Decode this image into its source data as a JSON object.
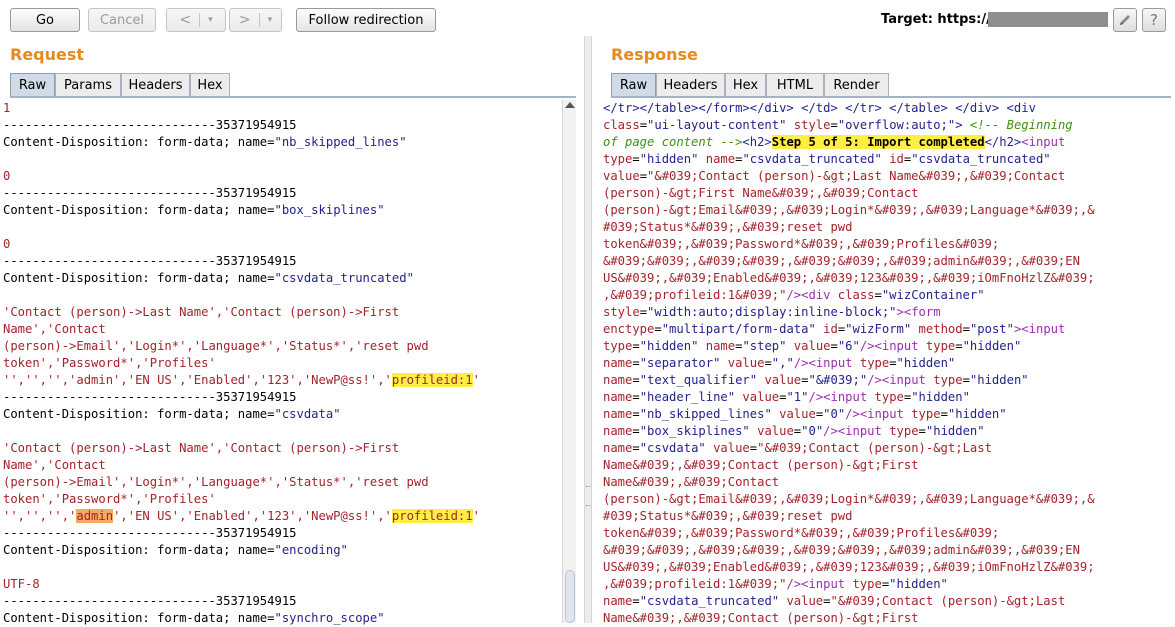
{
  "toolbar": {
    "go_label": "Go",
    "cancel_label": "Cancel",
    "back_glyph": "<",
    "forward_glyph": ">",
    "dropdown_glyph": "▾",
    "follow_label": "Follow redirection",
    "target_label": "Target: https://"
  },
  "request": {
    "title": "Request",
    "tabs": [
      "Raw",
      "Params",
      "Headers",
      "Hex"
    ],
    "lines": [
      [
        {
          "t": "1",
          "c": "red"
        }
      ],
      [
        {
          "t": "-----------------------------35371954915",
          "c": "black"
        }
      ],
      [
        {
          "t": "Content-Disposition: form-data; name=",
          "c": "black"
        },
        {
          "t": "\"nb_skipped_lines\"",
          "c": "blue"
        }
      ],
      [],
      [
        {
          "t": "0",
          "c": "red"
        }
      ],
      [
        {
          "t": "-----------------------------35371954915",
          "c": "black"
        }
      ],
      [
        {
          "t": "Content-Disposition: form-data; name=",
          "c": "black"
        },
        {
          "t": "\"box_skiplines\"",
          "c": "blue"
        }
      ],
      [],
      [
        {
          "t": "0",
          "c": "red"
        }
      ],
      [
        {
          "t": "-----------------------------35371954915",
          "c": "black"
        }
      ],
      [
        {
          "t": "Content-Disposition: form-data; name=",
          "c": "black"
        },
        {
          "t": "\"csvdata_truncated\"",
          "c": "blue"
        }
      ],
      [],
      [
        {
          "t": "'Contact (person)->Last Name','Contact (person)->First",
          "c": "red"
        }
      ],
      [
        {
          "t": "Name','Contact",
          "c": "red"
        }
      ],
      [
        {
          "t": "(person)->Email','Login*','Language*','Status*','reset pwd",
          "c": "red"
        }
      ],
      [
        {
          "t": "token','Password*','Profiles'",
          "c": "red"
        }
      ],
      [
        {
          "t": "'','','','admin','EN US','Enabled','123','NewP@ss!','",
          "c": "red"
        },
        {
          "t": "profileid:1",
          "c": "red",
          "hl": "yellow"
        },
        {
          "t": "'",
          "c": "red"
        }
      ],
      [
        {
          "t": "-----------------------------35371954915",
          "c": "black"
        }
      ],
      [
        {
          "t": "Content-Disposition: form-data; name=",
          "c": "black"
        },
        {
          "t": "\"csvdata\"",
          "c": "blue"
        }
      ],
      [],
      [
        {
          "t": "'Contact (person)->Last Name','Contact (person)->First",
          "c": "red"
        }
      ],
      [
        {
          "t": "Name','Contact",
          "c": "red"
        }
      ],
      [
        {
          "t": "(person)->Email','Login*','Language*','Status*','reset pwd",
          "c": "red"
        }
      ],
      [
        {
          "t": "token','Password*','Profiles'",
          "c": "red"
        }
      ],
      [
        {
          "t": "'','','','",
          "c": "red"
        },
        {
          "t": "admin",
          "c": "red",
          "hl": "orange"
        },
        {
          "t": "','EN US','Enabled','123','NewP@ss!','",
          "c": "red"
        },
        {
          "t": "profileid:1",
          "c": "red",
          "hl": "yellow"
        },
        {
          "t": "'",
          "c": "red"
        }
      ],
      [
        {
          "t": "-----------------------------35371954915",
          "c": "black"
        }
      ],
      [
        {
          "t": "Content-Disposition: form-data; name=",
          "c": "black"
        },
        {
          "t": "\"encoding\"",
          "c": "blue"
        }
      ],
      [],
      [
        {
          "t": "UTF-8",
          "c": "red"
        }
      ],
      [
        {
          "t": "-----------------------------35371954915",
          "c": "black"
        }
      ],
      [
        {
          "t": "Content-Disposition: form-data; name=",
          "c": "black"
        },
        {
          "t": "\"synchro_scope\"",
          "c": "blue"
        }
      ]
    ]
  },
  "response": {
    "title": "Response",
    "tabs": [
      "Raw",
      "Headers",
      "Hex",
      "HTML",
      "Render"
    ],
    "lines": [
      [
        {
          "t": "</tr></table></form></div> </td> </tr> </table> </div> <div",
          "c": "blue"
        }
      ],
      [
        {
          "t": "class",
          "c": "red"
        },
        {
          "t": "=",
          "c": "black"
        },
        {
          "t": "\"ui-layout-content\"",
          "c": "blue"
        },
        {
          "t": " style",
          "c": "red"
        },
        {
          "t": "=",
          "c": "black"
        },
        {
          "t": "\"overflow:auto;\"",
          "c": "blue"
        },
        {
          "t": "> ",
          "c": "blue"
        },
        {
          "t": "<!-- Beginning",
          "c": "green"
        }
      ],
      [
        {
          "t": "of page content -->",
          "c": "green"
        },
        {
          "t": "<h2>",
          "c": "blue"
        },
        {
          "t": "Step 5 of 5: Import completed",
          "c": "black",
          "hl": "yellow",
          "b": true
        },
        {
          "t": "</h2>",
          "c": "blue"
        },
        {
          "t": "<input",
          "c": "purple"
        }
      ],
      [
        {
          "t": "type",
          "c": "red"
        },
        {
          "t": "=",
          "c": "black"
        },
        {
          "t": "\"hidden\"",
          "c": "blue"
        },
        {
          "t": " name",
          "c": "red"
        },
        {
          "t": "=",
          "c": "black"
        },
        {
          "t": "\"csvdata_truncated\"",
          "c": "blue"
        },
        {
          "t": " id",
          "c": "red"
        },
        {
          "t": "=",
          "c": "black"
        },
        {
          "t": "\"csvdata_truncated\"",
          "c": "blue"
        }
      ],
      [
        {
          "t": "value",
          "c": "red"
        },
        {
          "t": "=",
          "c": "black"
        },
        {
          "t": "\"&#039;Contact (person)-&gt;Last Name&#039;,&#039;Contact",
          "c": "red"
        }
      ],
      [
        {
          "t": "(person)-&gt;First Name&#039;,&#039;Contact",
          "c": "red"
        }
      ],
      [
        {
          "t": "(person)-&gt;Email&#039;,&#039;Login*&#039;,&#039;Language*&#039;,&",
          "c": "red"
        }
      ],
      [
        {
          "t": "#039;Status*&#039;,&#039;reset pwd",
          "c": "red"
        }
      ],
      [
        {
          "t": "token&#039;,&#039;Password*&#039;,&#039;Profiles&#039;",
          "c": "red"
        }
      ],
      [
        {
          "t": "&#039;&#039;,&#039;&#039;,&#039;&#039;,&#039;admin&#039;,&#039;EN",
          "c": "red"
        }
      ],
      [
        {
          "t": "US&#039;,&#039;Enabled&#039;,&#039;123&#039;,&#039;iOmFnoHzlZ&#039;",
          "c": "red"
        }
      ],
      [
        {
          "t": ",&#039;profileid:1&#039;\"",
          "c": "red"
        },
        {
          "t": "/><div",
          "c": "purple"
        },
        {
          "t": " class",
          "c": "red"
        },
        {
          "t": "=",
          "c": "black"
        },
        {
          "t": "\"wizContainer\"",
          "c": "blue"
        }
      ],
      [
        {
          "t": "style",
          "c": "red"
        },
        {
          "t": "=",
          "c": "black"
        },
        {
          "t": "\"width:auto;display:inline-block;\"",
          "c": "blue"
        },
        {
          "t": "><form",
          "c": "purple"
        }
      ],
      [
        {
          "t": "enctype",
          "c": "red"
        },
        {
          "t": "=",
          "c": "black"
        },
        {
          "t": "\"multipart/form-data\"",
          "c": "blue"
        },
        {
          "t": " id",
          "c": "red"
        },
        {
          "t": "=",
          "c": "black"
        },
        {
          "t": "\"wizForm\"",
          "c": "blue"
        },
        {
          "t": " method",
          "c": "red"
        },
        {
          "t": "=",
          "c": "black"
        },
        {
          "t": "\"post\"",
          "c": "blue"
        },
        {
          "t": "><input",
          "c": "purple"
        }
      ],
      [
        {
          "t": "type",
          "c": "red"
        },
        {
          "t": "=",
          "c": "black"
        },
        {
          "t": "\"hidden\"",
          "c": "blue"
        },
        {
          "t": " name",
          "c": "red"
        },
        {
          "t": "=",
          "c": "black"
        },
        {
          "t": "\"step\"",
          "c": "blue"
        },
        {
          "t": " value",
          "c": "red"
        },
        {
          "t": "=",
          "c": "black"
        },
        {
          "t": "\"6\"",
          "c": "blue"
        },
        {
          "t": "/><input",
          "c": "purple"
        },
        {
          "t": " type",
          "c": "red"
        },
        {
          "t": "=",
          "c": "black"
        },
        {
          "t": "\"hidden\"",
          "c": "blue"
        }
      ],
      [
        {
          "t": "name",
          "c": "red"
        },
        {
          "t": "=",
          "c": "black"
        },
        {
          "t": "\"separator\"",
          "c": "blue"
        },
        {
          "t": " value",
          "c": "red"
        },
        {
          "t": "=",
          "c": "black"
        },
        {
          "t": "\",\"",
          "c": "blue"
        },
        {
          "t": "/><input",
          "c": "purple"
        },
        {
          "t": " type",
          "c": "red"
        },
        {
          "t": "=",
          "c": "black"
        },
        {
          "t": "\"hidden\"",
          "c": "blue"
        }
      ],
      [
        {
          "t": "name",
          "c": "red"
        },
        {
          "t": "=",
          "c": "black"
        },
        {
          "t": "\"text_qualifier\"",
          "c": "blue"
        },
        {
          "t": " value",
          "c": "red"
        },
        {
          "t": "=",
          "c": "black"
        },
        {
          "t": "\"&#039;\"",
          "c": "blue"
        },
        {
          "t": "/><input",
          "c": "purple"
        },
        {
          "t": " type",
          "c": "red"
        },
        {
          "t": "=",
          "c": "black"
        },
        {
          "t": "\"hidden\"",
          "c": "blue"
        }
      ],
      [
        {
          "t": "name",
          "c": "red"
        },
        {
          "t": "=",
          "c": "black"
        },
        {
          "t": "\"header_line\"",
          "c": "blue"
        },
        {
          "t": " value",
          "c": "red"
        },
        {
          "t": "=",
          "c": "black"
        },
        {
          "t": "\"1\"",
          "c": "blue"
        },
        {
          "t": "/><input",
          "c": "purple"
        },
        {
          "t": " type",
          "c": "red"
        },
        {
          "t": "=",
          "c": "black"
        },
        {
          "t": "\"hidden\"",
          "c": "blue"
        }
      ],
      [
        {
          "t": "name",
          "c": "red"
        },
        {
          "t": "=",
          "c": "black"
        },
        {
          "t": "\"nb_skipped_lines\"",
          "c": "blue"
        },
        {
          "t": " value",
          "c": "red"
        },
        {
          "t": "=",
          "c": "black"
        },
        {
          "t": "\"0\"",
          "c": "blue"
        },
        {
          "t": "/><input",
          "c": "purple"
        },
        {
          "t": " type",
          "c": "red"
        },
        {
          "t": "=",
          "c": "black"
        },
        {
          "t": "\"hidden\"",
          "c": "blue"
        }
      ],
      [
        {
          "t": "name",
          "c": "red"
        },
        {
          "t": "=",
          "c": "black"
        },
        {
          "t": "\"box_skiplines\"",
          "c": "blue"
        },
        {
          "t": " value",
          "c": "red"
        },
        {
          "t": "=",
          "c": "black"
        },
        {
          "t": "\"0\"",
          "c": "blue"
        },
        {
          "t": "/><input",
          "c": "purple"
        },
        {
          "t": " type",
          "c": "red"
        },
        {
          "t": "=",
          "c": "black"
        },
        {
          "t": "\"hidden\"",
          "c": "blue"
        }
      ],
      [
        {
          "t": "name",
          "c": "red"
        },
        {
          "t": "=",
          "c": "black"
        },
        {
          "t": "\"csvdata\"",
          "c": "blue"
        },
        {
          "t": " value",
          "c": "red"
        },
        {
          "t": "=",
          "c": "black"
        },
        {
          "t": "\"&#039;Contact (person)-&gt;Last",
          "c": "red"
        }
      ],
      [
        {
          "t": "Name&#039;,&#039;Contact (person)-&gt;First",
          "c": "red"
        }
      ],
      [
        {
          "t": "Name&#039;,&#039;Contact",
          "c": "red"
        }
      ],
      [
        {
          "t": "(person)-&gt;Email&#039;,&#039;Login*&#039;,&#039;Language*&#039;,&",
          "c": "red"
        }
      ],
      [
        {
          "t": "#039;Status*&#039;,&#039;reset pwd",
          "c": "red"
        }
      ],
      [
        {
          "t": "token&#039;,&#039;Password*&#039;,&#039;Profiles&#039;",
          "c": "red"
        }
      ],
      [
        {
          "t": "&#039;&#039;,&#039;&#039;,&#039;&#039;,&#039;admin&#039;,&#039;EN",
          "c": "red"
        }
      ],
      [
        {
          "t": "US&#039;,&#039;Enabled&#039;,&#039;123&#039;,&#039;iOmFnoHzlZ&#039;",
          "c": "red"
        }
      ],
      [
        {
          "t": ",&#039;profileid:1&#039;\"",
          "c": "red"
        },
        {
          "t": "/><input",
          "c": "purple"
        },
        {
          "t": " type",
          "c": "red"
        },
        {
          "t": "=",
          "c": "black"
        },
        {
          "t": "\"hidden\"",
          "c": "blue"
        }
      ],
      [
        {
          "t": "name",
          "c": "red"
        },
        {
          "t": "=",
          "c": "black"
        },
        {
          "t": "\"csvdata_truncated\"",
          "c": "blue"
        },
        {
          "t": " value",
          "c": "red"
        },
        {
          "t": "=",
          "c": "black"
        },
        {
          "t": "\"&#039;Contact (person)-&gt;Last",
          "c": "red"
        }
      ],
      [
        {
          "t": "Name&#039;,&#039;Contact (person)-&gt;First",
          "c": "red"
        }
      ]
    ]
  },
  "icons": {
    "edit": "pencil-icon",
    "help": "help-icon"
  },
  "colors": {
    "accent": "#e58a1f",
    "highlight": "#ffee44",
    "search_highlight": "#f5a962"
  }
}
